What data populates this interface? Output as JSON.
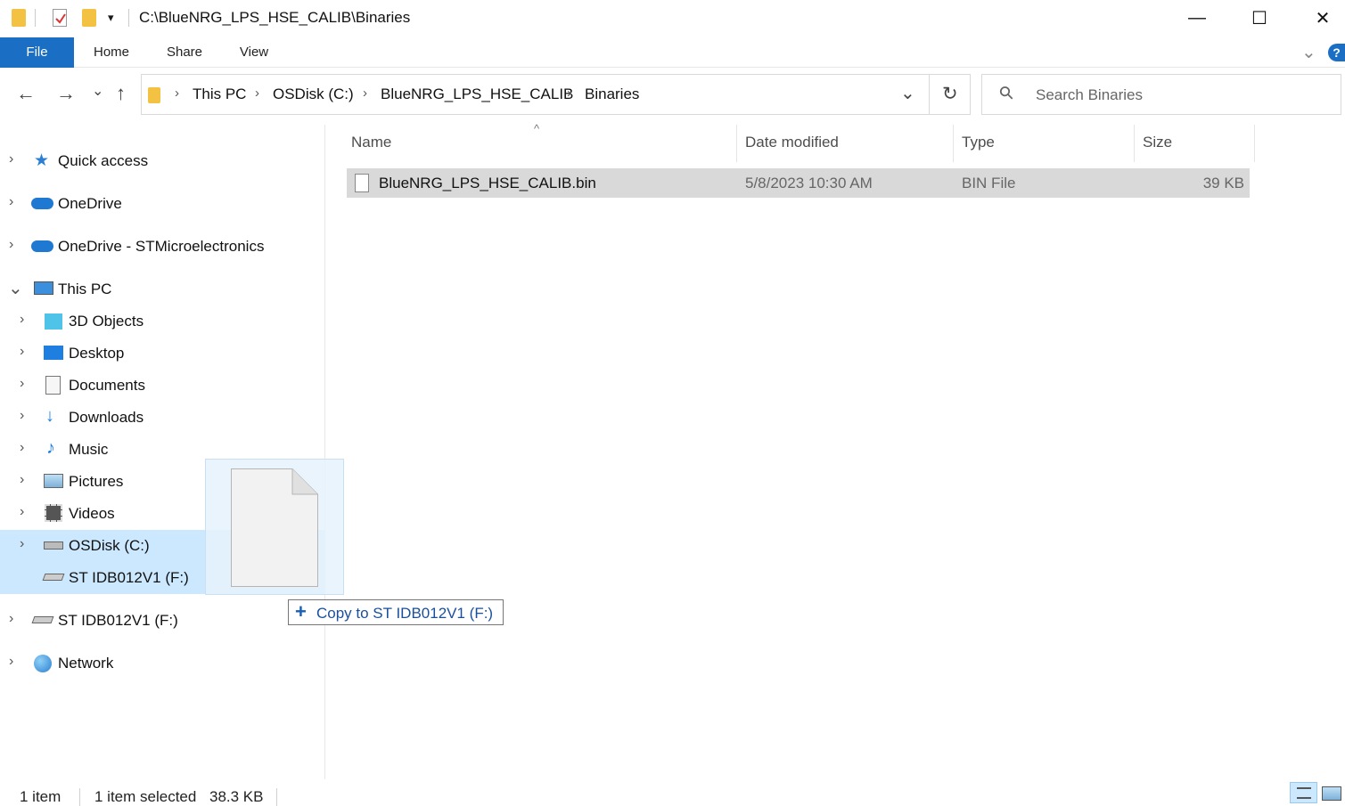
{
  "window": {
    "title": "C:\\BlueNRG_LPS_HSE_CALIB\\Binaries",
    "minimize_glyph": "—",
    "maximize_glyph": "☐",
    "close_glyph": "✕"
  },
  "ribbon": {
    "tabs": [
      "File",
      "Home",
      "Share",
      "View"
    ],
    "expand_glyph": "⌄",
    "help_glyph": "?"
  },
  "address": {
    "back_glyph": "←",
    "forward_glyph": "→",
    "recent_glyph": "⌄",
    "up_glyph": "↑",
    "crumbs": [
      "This PC",
      "OSDisk (C:)",
      "BlueNRG_LPS_HSE_CALIB",
      "Binaries"
    ],
    "sep_glyph": "›",
    "dropdown_glyph": "⌄",
    "refresh_glyph": "↻",
    "search_placeholder": "Search Binaries",
    "search_glyph": "⚲"
  },
  "sidebar": {
    "items": [
      {
        "label": "Quick access",
        "icon": "star-icon"
      },
      {
        "label": "OneDrive",
        "icon": "cloud-icon"
      },
      {
        "label": "OneDrive - STMicroelectronics",
        "icon": "cloud-icon"
      },
      {
        "label": "This PC",
        "icon": "computer-icon"
      },
      {
        "label": "3D Objects",
        "icon": "cube-icon"
      },
      {
        "label": "Desktop",
        "icon": "desktop-icon"
      },
      {
        "label": "Documents",
        "icon": "documents-icon"
      },
      {
        "label": "Downloads",
        "icon": "download-icon"
      },
      {
        "label": "Music",
        "icon": "music-icon"
      },
      {
        "label": "Pictures",
        "icon": "pictures-icon"
      },
      {
        "label": "Videos",
        "icon": "video-icon"
      },
      {
        "label": "OSDisk (C:)",
        "icon": "drive-icon"
      },
      {
        "label": "ST IDB012V1 (F:)",
        "icon": "usb-drive-icon"
      },
      {
        "label": "ST IDB012V1 (F:)",
        "icon": "usb-drive-icon"
      },
      {
        "label": "Network",
        "icon": "network-icon"
      }
    ],
    "chev_right": "›",
    "chev_down": "⌄"
  },
  "columns": {
    "name": "Name",
    "date": "Date modified",
    "type": "Type",
    "size": "Size",
    "sort_glyph": "^"
  },
  "files": [
    {
      "name": "BlueNRG_LPS_HSE_CALIB.bin",
      "date": "5/8/2023 10:30 AM",
      "type": "BIN File",
      "size": "39 KB"
    }
  ],
  "drag": {
    "plus": "+",
    "tooltip": "Copy to ST IDB012V1 (F:)"
  },
  "status": {
    "count": "1 item",
    "selected": "1 item selected",
    "size": "38.3 KB"
  },
  "colors": {
    "accent": "#1a6fc4",
    "selection": "#cce8ff",
    "row_selected": "#d9d9d9"
  }
}
